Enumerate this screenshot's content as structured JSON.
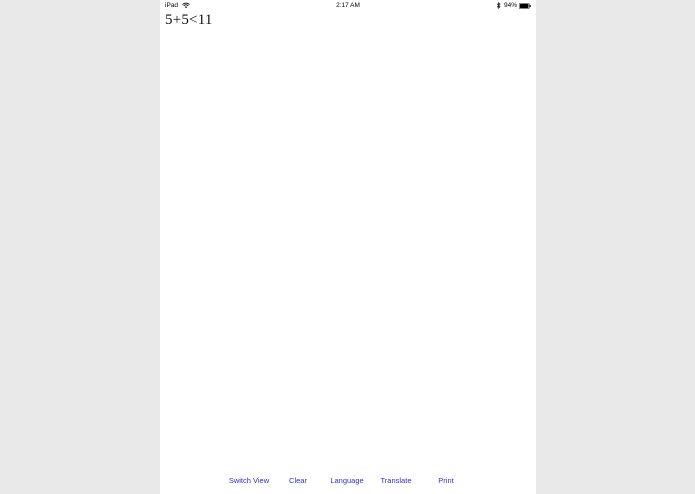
{
  "status_bar": {
    "device": "iPad",
    "time": "2:17 AM",
    "battery": "94%",
    "icons": [
      "wifi-icon",
      "bluetooth-icon",
      "battery-icon"
    ]
  },
  "expression": "5+5<11",
  "toolbar": {
    "buttons": [
      {
        "label": "Switch View"
      },
      {
        "label": "Clear"
      },
      {
        "label": "Language"
      },
      {
        "label": "Translate"
      },
      {
        "label": "Print"
      }
    ]
  },
  "colors": {
    "toolbar_text": "#2f2fd6",
    "background": "#ffffff"
  }
}
